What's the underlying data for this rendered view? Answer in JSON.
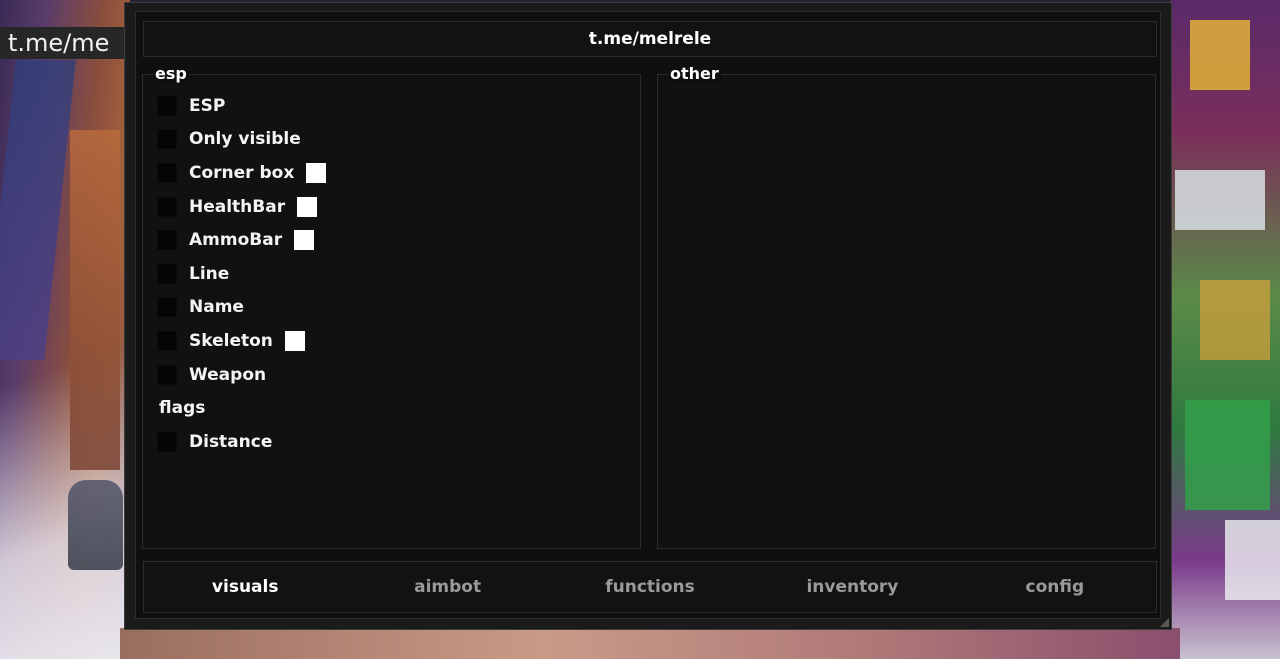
{
  "background_label": "t.me/me",
  "window": {
    "title": "t.me/melrele"
  },
  "groups": {
    "esp": {
      "title": "esp",
      "items": [
        {
          "label": "ESP",
          "checked": false,
          "color": null
        },
        {
          "label": "Only visible",
          "checked": false,
          "color": null
        },
        {
          "label": "Corner box",
          "checked": false,
          "color": "#ffffff"
        },
        {
          "label": "HealthBar",
          "checked": false,
          "color": "#ffffff"
        },
        {
          "label": "AmmoBar",
          "checked": false,
          "color": "#ffffff"
        },
        {
          "label": "Line",
          "checked": false,
          "color": null
        },
        {
          "label": "Name",
          "checked": false,
          "color": null
        },
        {
          "label": "Skeleton",
          "checked": false,
          "color": "#ffffff"
        },
        {
          "label": "Weapon",
          "checked": false,
          "color": null
        }
      ],
      "flags_label": "flags",
      "flags_items": [
        {
          "label": "Distance",
          "checked": false,
          "color": null
        }
      ]
    },
    "other": {
      "title": "other"
    }
  },
  "tabs": [
    {
      "label": "visuals",
      "active": true
    },
    {
      "label": "aimbot",
      "active": false
    },
    {
      "label": "functions",
      "active": false
    },
    {
      "label": "inventory",
      "active": false
    },
    {
      "label": "config",
      "active": false
    }
  ],
  "colors": {
    "window_bg": "#0f0f0f",
    "border": "#2c2c2c",
    "text_active": "#ffffff",
    "text_inactive": "#9a9a9a"
  }
}
